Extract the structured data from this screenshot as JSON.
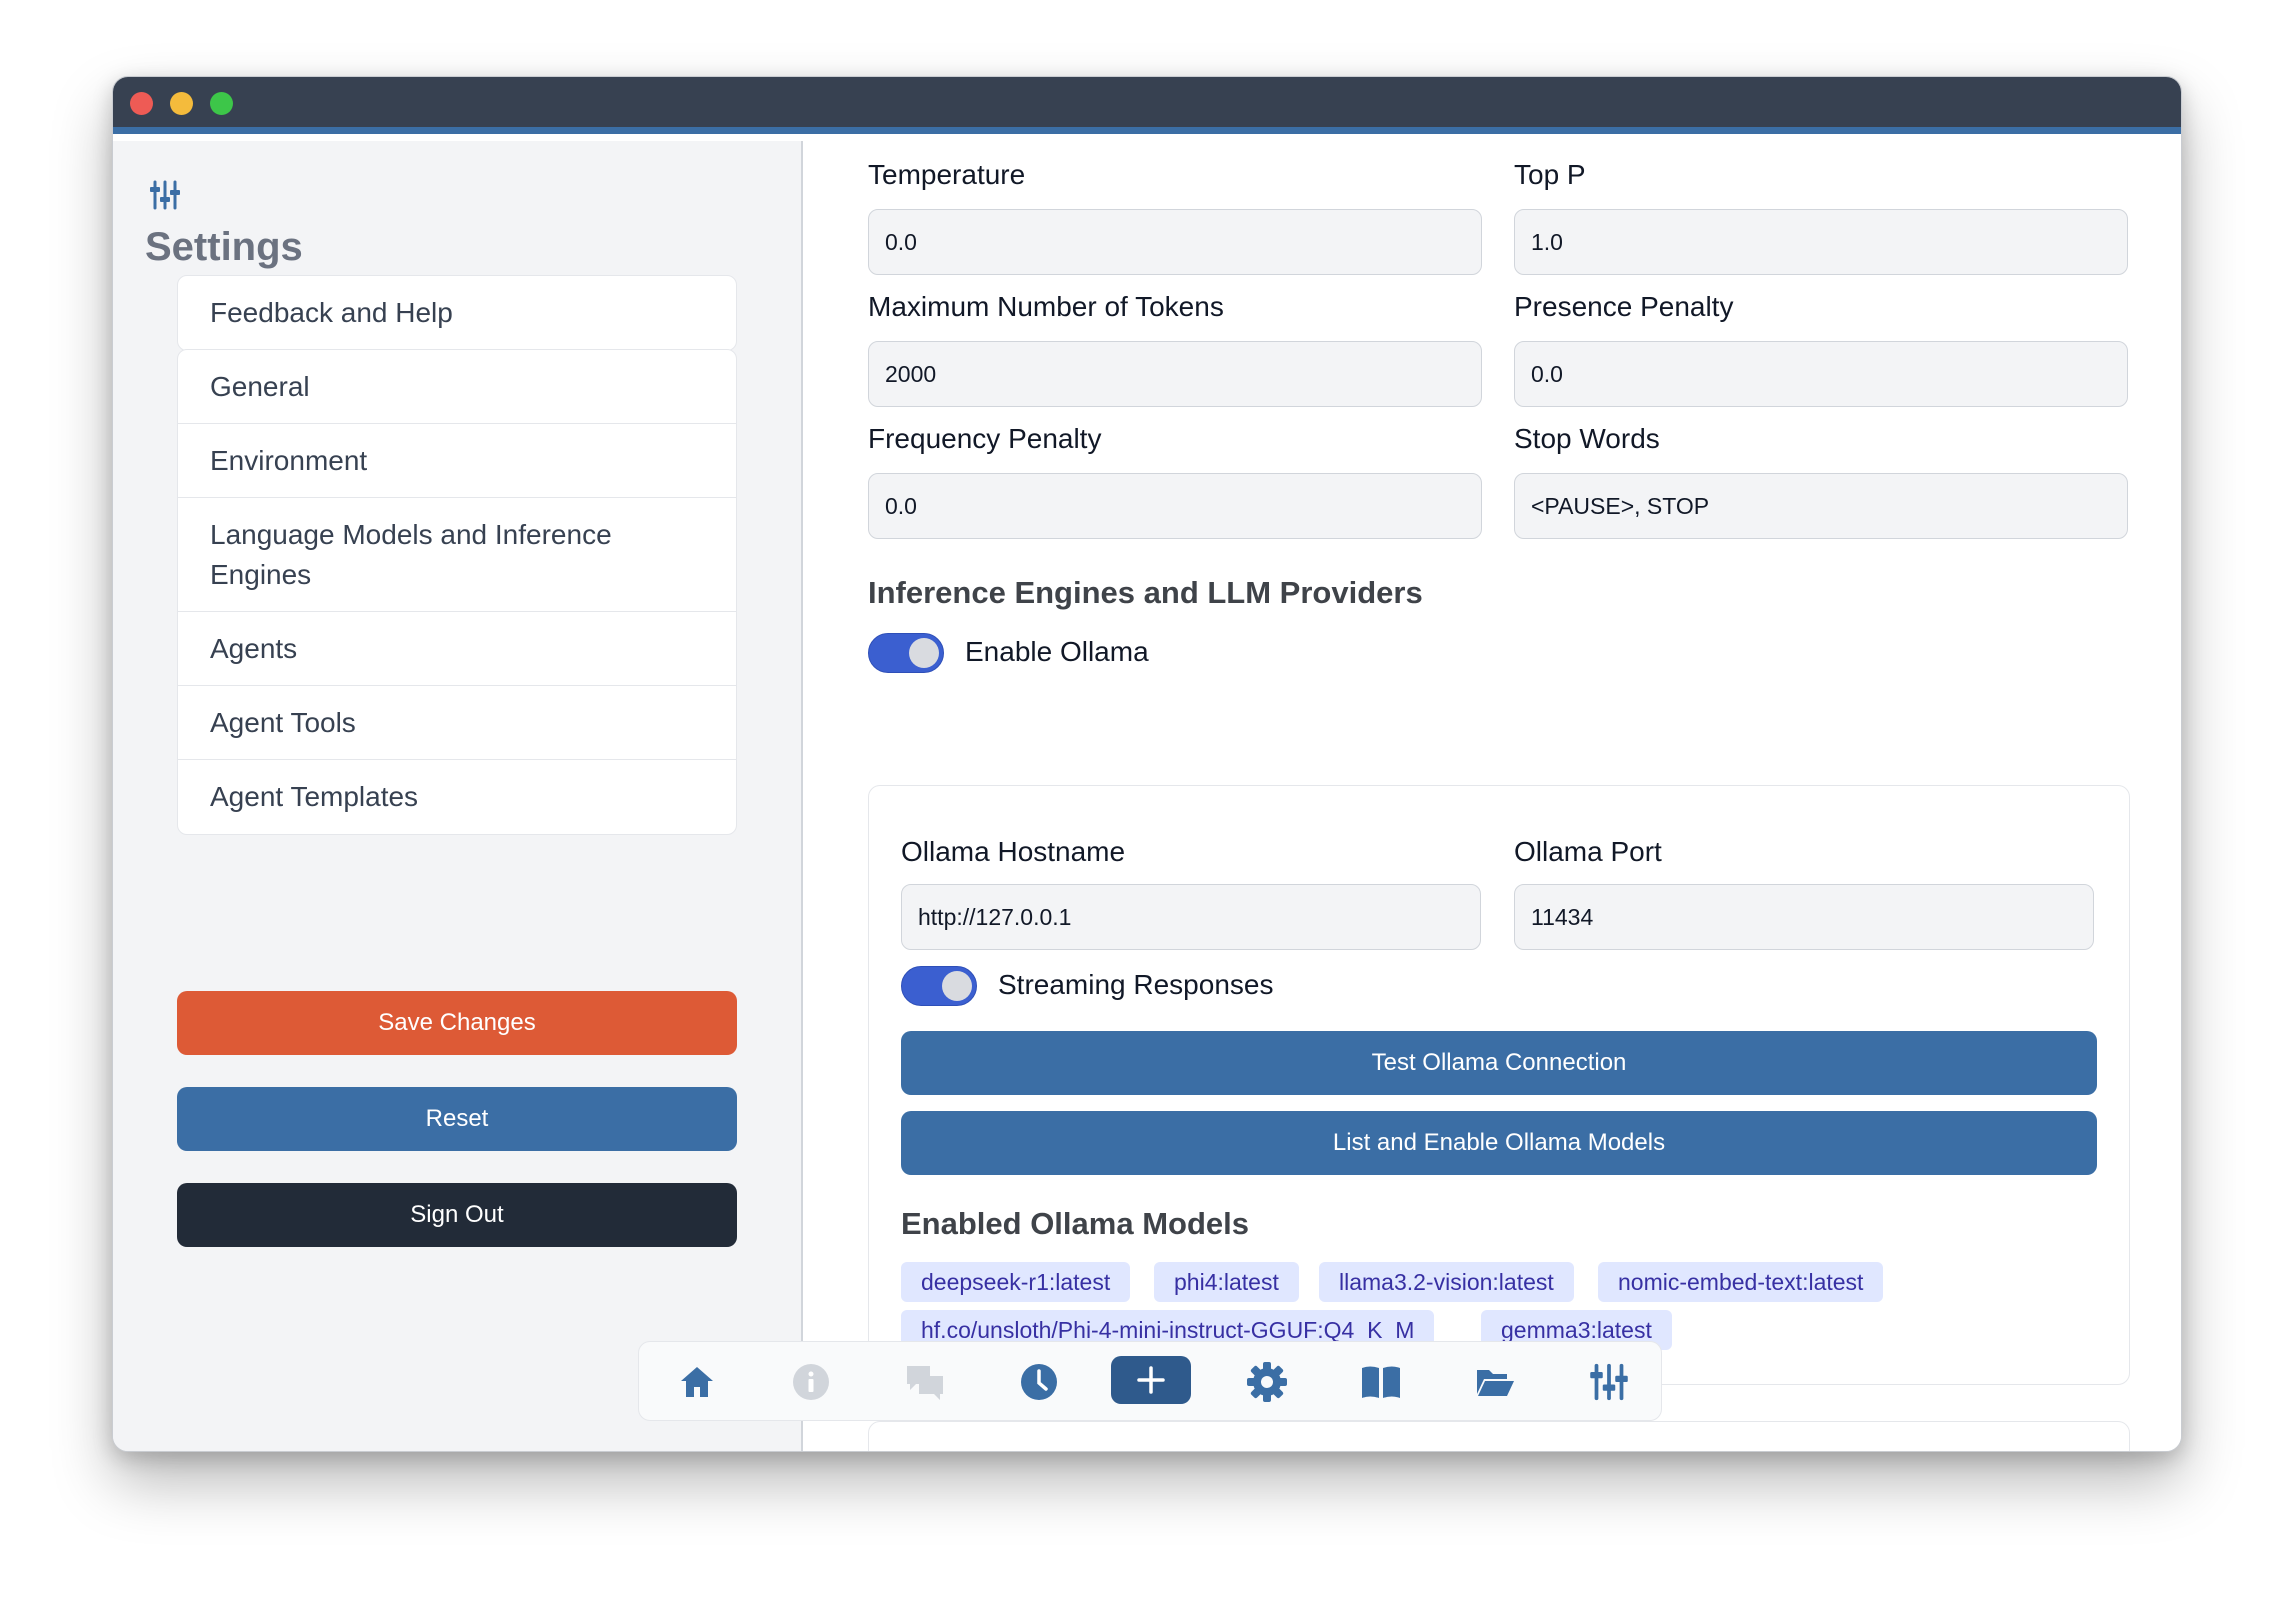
{
  "sidebar": {
    "title": "Settings",
    "help_item": "Feedback and Help",
    "items": [
      {
        "label": "General"
      },
      {
        "label": "Environment"
      },
      {
        "label": "Language Models and Inference Engines"
      },
      {
        "label": "Agents"
      },
      {
        "label": "Agent Tools"
      },
      {
        "label": "Agent Templates"
      }
    ],
    "save_label": "Save Changes",
    "reset_label": "Reset",
    "signout_label": "Sign Out"
  },
  "params": {
    "temperature_label": "Temperature",
    "temperature_value": "0.0",
    "top_p_label": "Top P",
    "top_p_value": "1.0",
    "max_tokens_label": "Maximum Number of Tokens",
    "max_tokens_value": "2000",
    "presence_penalty_label": "Presence Penalty",
    "presence_penalty_value": "0.0",
    "frequency_penalty_label": "Frequency Penalty",
    "frequency_penalty_value": "0.0",
    "stop_words_label": "Stop Words",
    "stop_words_value": "<PAUSE>, STOP"
  },
  "providers": {
    "section_title": "Inference Engines and LLM Providers",
    "enable_ollama_label": "Enable Ollama",
    "enable_ollama_on": true
  },
  "ollama": {
    "hostname_label": "Ollama Hostname",
    "hostname_value": "http://127.0.0.1",
    "port_label": "Ollama Port",
    "port_value": "11434",
    "streaming_label": "Streaming Responses",
    "streaming_on": true,
    "test_button": "Test Ollama Connection",
    "list_button": "List and Enable Ollama Models",
    "enabled_title": "Enabled Ollama Models",
    "models": [
      "deepseek-r1:latest",
      "phi4:latest",
      "llama3.2-vision:latest",
      "nomic-embed-text:latest",
      "hf.co/unsloth/Phi-4-mini-instruct-GGUF:Q4_K_M",
      "gemma3:latest"
    ]
  },
  "dock": {
    "items": [
      "home-icon",
      "info-icon",
      "chat-icon",
      "clock-icon",
      "plus-icon",
      "gear-icon",
      "book-icon",
      "folder-open-icon",
      "sliders-icon"
    ],
    "accent": "#3b6ea5",
    "muted": "#d1d5db"
  }
}
